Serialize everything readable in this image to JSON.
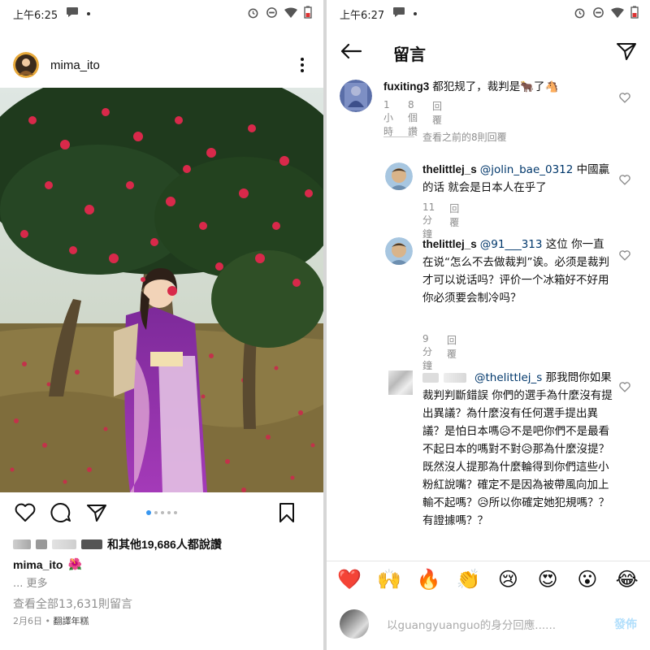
{
  "left": {
    "status": {
      "time": "上午6:25"
    },
    "post": {
      "username": "mima_ito",
      "likes_text": "和其他19,686人都說讚",
      "caption_user": "mima_ito",
      "caption_emoji": "🌺",
      "more_text": "... 更多",
      "view_all_comments": "查看全部13,631則留言",
      "date": "2月6日",
      "translate": "翻譯年糕",
      "carousel": {
        "count": 5,
        "active": 1
      }
    }
  },
  "right": {
    "status": {
      "time": "上午6:27"
    },
    "header": {
      "title": "留言"
    },
    "comments": [
      {
        "user": "fuxiting3",
        "text": "都犯规了，裁判是🐂了🐴",
        "time": "1小時",
        "likes": "8個讚",
        "reply": "回覆"
      },
      {
        "user": "thelittlej_s",
        "mention": "@jolin_bae_0312",
        "text": "中國贏的话 就会是日本人在乎了",
        "time": "11分鐘",
        "reply": "回覆"
      },
      {
        "user": "thelittlej_s",
        "mention": "@91___313",
        "text": "这位 你一直在说“怎么不去做裁判”诶。必须是裁判才可以说话吗？评价一个冰箱好不好用 你必须要会制冷吗？",
        "time": "9分鐘",
        "reply": "回覆"
      },
      {
        "user": "",
        "mention": "@thelittlej_s",
        "text": "那我問你如果裁判判斷錯誤 你們的選手為什麼沒有提出異議？為什麼沒有任何選手提出異議？是怕日本嗎😥不是吧你們不是最看不起日本的嗎對不對😥那為什麼沒提？既然沒人提那為什麼輪得到你們這些小粉紅說嘴？確定不是因為被帶風向加上輸不起嗎？😥所以你確定她犯規嗎？？有證據嗎？？"
      }
    ],
    "prev_replies": "查看之前的8則回覆",
    "emojis": [
      "❤️",
      "🙌",
      "🔥",
      "👏",
      "😢",
      "😍",
      "😮",
      "😂"
    ],
    "reply_placeholder": "以guangyuanguo的身分回應......",
    "post_button": "發佈"
  },
  "colors": {
    "link": "#00376b",
    "accent": "#3897f0",
    "muted": "#8e8e8e"
  }
}
